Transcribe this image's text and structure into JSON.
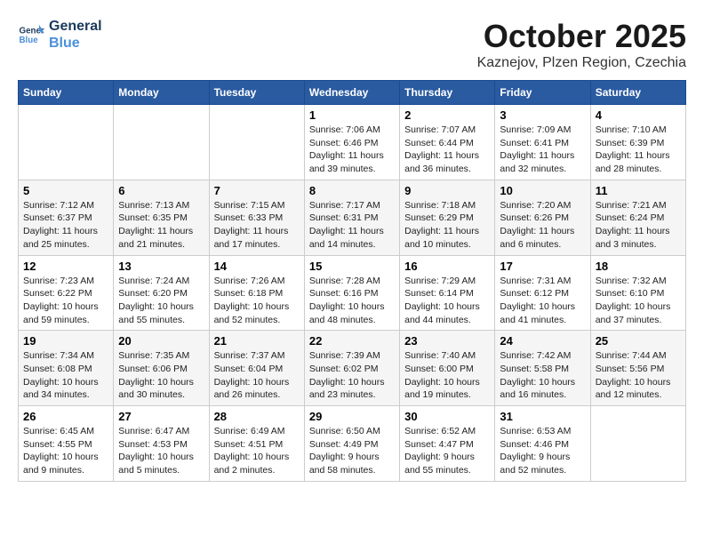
{
  "header": {
    "logo_line1": "General",
    "logo_line2": "Blue",
    "month_title": "October 2025",
    "location": "Kaznejov, Plzen Region, Czechia"
  },
  "weekdays": [
    "Sunday",
    "Monday",
    "Tuesday",
    "Wednesday",
    "Thursday",
    "Friday",
    "Saturday"
  ],
  "weeks": [
    [
      {
        "day": "",
        "detail": ""
      },
      {
        "day": "",
        "detail": ""
      },
      {
        "day": "",
        "detail": ""
      },
      {
        "day": "1",
        "detail": "Sunrise: 7:06 AM\nSunset: 6:46 PM\nDaylight: 11 hours\nand 39 minutes."
      },
      {
        "day": "2",
        "detail": "Sunrise: 7:07 AM\nSunset: 6:44 PM\nDaylight: 11 hours\nand 36 minutes."
      },
      {
        "day": "3",
        "detail": "Sunrise: 7:09 AM\nSunset: 6:41 PM\nDaylight: 11 hours\nand 32 minutes."
      },
      {
        "day": "4",
        "detail": "Sunrise: 7:10 AM\nSunset: 6:39 PM\nDaylight: 11 hours\nand 28 minutes."
      }
    ],
    [
      {
        "day": "5",
        "detail": "Sunrise: 7:12 AM\nSunset: 6:37 PM\nDaylight: 11 hours\nand 25 minutes."
      },
      {
        "day": "6",
        "detail": "Sunrise: 7:13 AM\nSunset: 6:35 PM\nDaylight: 11 hours\nand 21 minutes."
      },
      {
        "day": "7",
        "detail": "Sunrise: 7:15 AM\nSunset: 6:33 PM\nDaylight: 11 hours\nand 17 minutes."
      },
      {
        "day": "8",
        "detail": "Sunrise: 7:17 AM\nSunset: 6:31 PM\nDaylight: 11 hours\nand 14 minutes."
      },
      {
        "day": "9",
        "detail": "Sunrise: 7:18 AM\nSunset: 6:29 PM\nDaylight: 11 hours\nand 10 minutes."
      },
      {
        "day": "10",
        "detail": "Sunrise: 7:20 AM\nSunset: 6:26 PM\nDaylight: 11 hours\nand 6 minutes."
      },
      {
        "day": "11",
        "detail": "Sunrise: 7:21 AM\nSunset: 6:24 PM\nDaylight: 11 hours\nand 3 minutes."
      }
    ],
    [
      {
        "day": "12",
        "detail": "Sunrise: 7:23 AM\nSunset: 6:22 PM\nDaylight: 10 hours\nand 59 minutes."
      },
      {
        "day": "13",
        "detail": "Sunrise: 7:24 AM\nSunset: 6:20 PM\nDaylight: 10 hours\nand 55 minutes."
      },
      {
        "day": "14",
        "detail": "Sunrise: 7:26 AM\nSunset: 6:18 PM\nDaylight: 10 hours\nand 52 minutes."
      },
      {
        "day": "15",
        "detail": "Sunrise: 7:28 AM\nSunset: 6:16 PM\nDaylight: 10 hours\nand 48 minutes."
      },
      {
        "day": "16",
        "detail": "Sunrise: 7:29 AM\nSunset: 6:14 PM\nDaylight: 10 hours\nand 44 minutes."
      },
      {
        "day": "17",
        "detail": "Sunrise: 7:31 AM\nSunset: 6:12 PM\nDaylight: 10 hours\nand 41 minutes."
      },
      {
        "day": "18",
        "detail": "Sunrise: 7:32 AM\nSunset: 6:10 PM\nDaylight: 10 hours\nand 37 minutes."
      }
    ],
    [
      {
        "day": "19",
        "detail": "Sunrise: 7:34 AM\nSunset: 6:08 PM\nDaylight: 10 hours\nand 34 minutes."
      },
      {
        "day": "20",
        "detail": "Sunrise: 7:35 AM\nSunset: 6:06 PM\nDaylight: 10 hours\nand 30 minutes."
      },
      {
        "day": "21",
        "detail": "Sunrise: 7:37 AM\nSunset: 6:04 PM\nDaylight: 10 hours\nand 26 minutes."
      },
      {
        "day": "22",
        "detail": "Sunrise: 7:39 AM\nSunset: 6:02 PM\nDaylight: 10 hours\nand 23 minutes."
      },
      {
        "day": "23",
        "detail": "Sunrise: 7:40 AM\nSunset: 6:00 PM\nDaylight: 10 hours\nand 19 minutes."
      },
      {
        "day": "24",
        "detail": "Sunrise: 7:42 AM\nSunset: 5:58 PM\nDaylight: 10 hours\nand 16 minutes."
      },
      {
        "day": "25",
        "detail": "Sunrise: 7:44 AM\nSunset: 5:56 PM\nDaylight: 10 hours\nand 12 minutes."
      }
    ],
    [
      {
        "day": "26",
        "detail": "Sunrise: 6:45 AM\nSunset: 4:55 PM\nDaylight: 10 hours\nand 9 minutes."
      },
      {
        "day": "27",
        "detail": "Sunrise: 6:47 AM\nSunset: 4:53 PM\nDaylight: 10 hours\nand 5 minutes."
      },
      {
        "day": "28",
        "detail": "Sunrise: 6:49 AM\nSunset: 4:51 PM\nDaylight: 10 hours\nand 2 minutes."
      },
      {
        "day": "29",
        "detail": "Sunrise: 6:50 AM\nSunset: 4:49 PM\nDaylight: 9 hours\nand 58 minutes."
      },
      {
        "day": "30",
        "detail": "Sunrise: 6:52 AM\nSunset: 4:47 PM\nDaylight: 9 hours\nand 55 minutes."
      },
      {
        "day": "31",
        "detail": "Sunrise: 6:53 AM\nSunset: 4:46 PM\nDaylight: 9 hours\nand 52 minutes."
      },
      {
        "day": "",
        "detail": ""
      }
    ]
  ]
}
